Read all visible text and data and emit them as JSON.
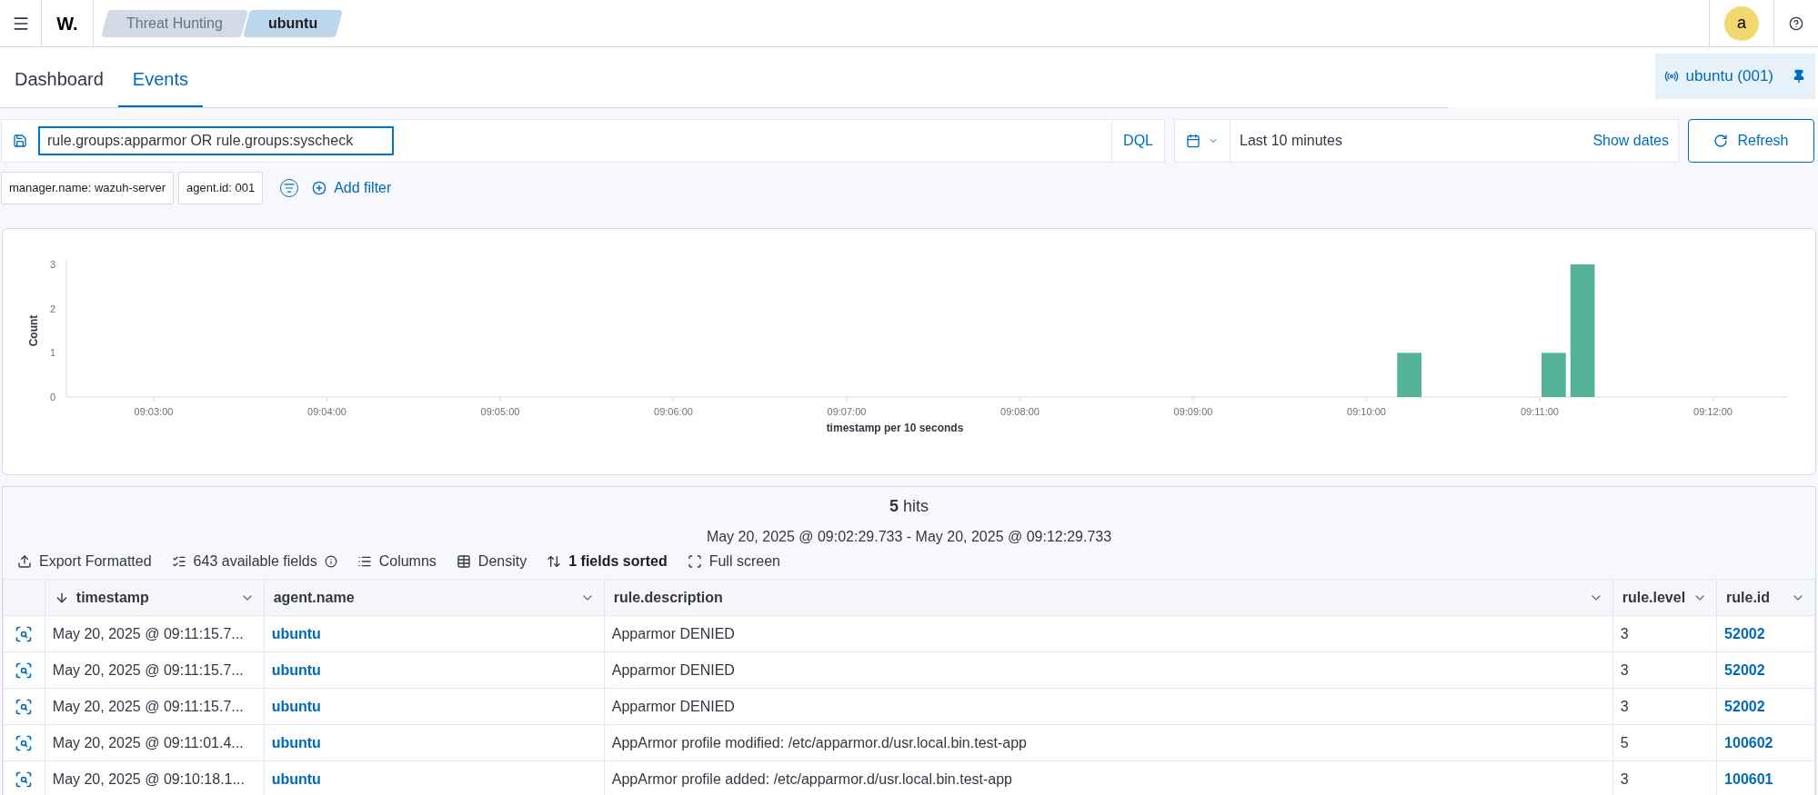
{
  "header": {
    "logo": "W.",
    "breadcrumbs": [
      {
        "label": "Threat Hunting",
        "selected": false
      },
      {
        "label": "ubuntu",
        "selected": true
      }
    ],
    "avatar": "a"
  },
  "tabs": [
    {
      "label": "Dashboard",
      "selected": false
    },
    {
      "label": "Events",
      "selected": true
    }
  ],
  "agent_badge": {
    "label": "ubuntu (001)"
  },
  "query": {
    "value": "rule.groups:apparmor OR rule.groups:syscheck",
    "language": "DQL"
  },
  "date_picker": {
    "range": "Last 10 minutes",
    "show_dates": "Show dates"
  },
  "refresh_button": "Refresh",
  "filters": [
    {
      "label": "manager.name: wazuh-server"
    },
    {
      "label": "agent.id: 001"
    }
  ],
  "add_filter": "Add filter",
  "histogram": {
    "chart_data": {
      "type": "bar",
      "xlabel": "timestamp per 10 seconds",
      "ylabel": "Count",
      "categories": [
        null,
        null,
        null,
        null,
        "09:03:00",
        null,
        null,
        null,
        null,
        null,
        "09:04:00",
        null,
        null,
        null,
        null,
        null,
        "09:05:00",
        null,
        null,
        null,
        null,
        null,
        "09:06:00",
        null,
        null,
        null,
        null,
        null,
        "09:07:00",
        null,
        null,
        null,
        null,
        null,
        "09:08:00",
        null,
        null,
        null,
        null,
        null,
        "09:09:00",
        null,
        null,
        null,
        null,
        null,
        "09:10:00",
        null,
        null,
        null,
        null,
        null,
        "09:11:00",
        null,
        null,
        null,
        null,
        null,
        "09:12:00",
        null,
        null
      ],
      "series": [
        {
          "color": "#54b399",
          "values": [
            0,
            0,
            0,
            0,
            0,
            0,
            0,
            0,
            0,
            0,
            0,
            0,
            0,
            0,
            0,
            0,
            0,
            0,
            0,
            0,
            0,
            0,
            0,
            0,
            0,
            0,
            0,
            0,
            0,
            0,
            0,
            0,
            0,
            0,
            0,
            0,
            0,
            0,
            0,
            0,
            0,
            0,
            0,
            0,
            0,
            0,
            0,
            1,
            0,
            0,
            0,
            0,
            1,
            3,
            0,
            0,
            0,
            0,
            0,
            0,
            0
          ]
        }
      ],
      "ylim": [
        0,
        3
      ],
      "yticks": [
        0,
        1,
        2,
        3
      ]
    }
  },
  "hits": {
    "count": "**5** hits",
    "range": "May 20, 2025 @ 09:02:29.733 - May 20, 2025 @ 09:12:29.733"
  },
  "toolbar": [
    {
      "kind": "export",
      "label": "Export Formatted"
    },
    {
      "kind": "fields",
      "label": "643 available fields"
    },
    {
      "kind": "columns",
      "label": "Columns"
    },
    {
      "kind": "density",
      "label": "Density"
    },
    {
      "kind": "sort",
      "label": "1 fields sorted"
    },
    {
      "kind": "fullscreen",
      "label": "Full screen"
    }
  ],
  "table": {
    "columns": [
      {
        "label": "timestamp",
        "sorted": true,
        "kind": "text"
      },
      {
        "label": "agent.name",
        "sorted": false,
        "kind": "link"
      },
      {
        "label": "rule.description",
        "sorted": false,
        "kind": "text"
      },
      {
        "label": "rule.level",
        "sorted": false,
        "kind": "text"
      },
      {
        "label": "rule.id",
        "sorted": false,
        "kind": "link"
      }
    ],
    "rows": [
      [
        "May 20, 2025 @ 09:11:15.7...",
        "ubuntu",
        "Apparmor DENIED",
        "3",
        "52002"
      ],
      [
        "May 20, 2025 @ 09:11:15.7...",
        "ubuntu",
        "Apparmor DENIED",
        "3",
        "52002"
      ],
      [
        "May 20, 2025 @ 09:11:15.7...",
        "ubuntu",
        "Apparmor DENIED",
        "3",
        "52002"
      ],
      [
        "May 20, 2025 @ 09:11:01.4...",
        "ubuntu",
        "AppArmor profile modified: /etc/apparmor.d/usr.local.bin.test-app",
        "5",
        "100602"
      ],
      [
        "May 20, 2025 @ 09:10:18.1...",
        "ubuntu",
        "AppArmor profile added: /etc/apparmor.d/usr.local.bin.test-app",
        "3",
        "100601"
      ]
    ]
  }
}
